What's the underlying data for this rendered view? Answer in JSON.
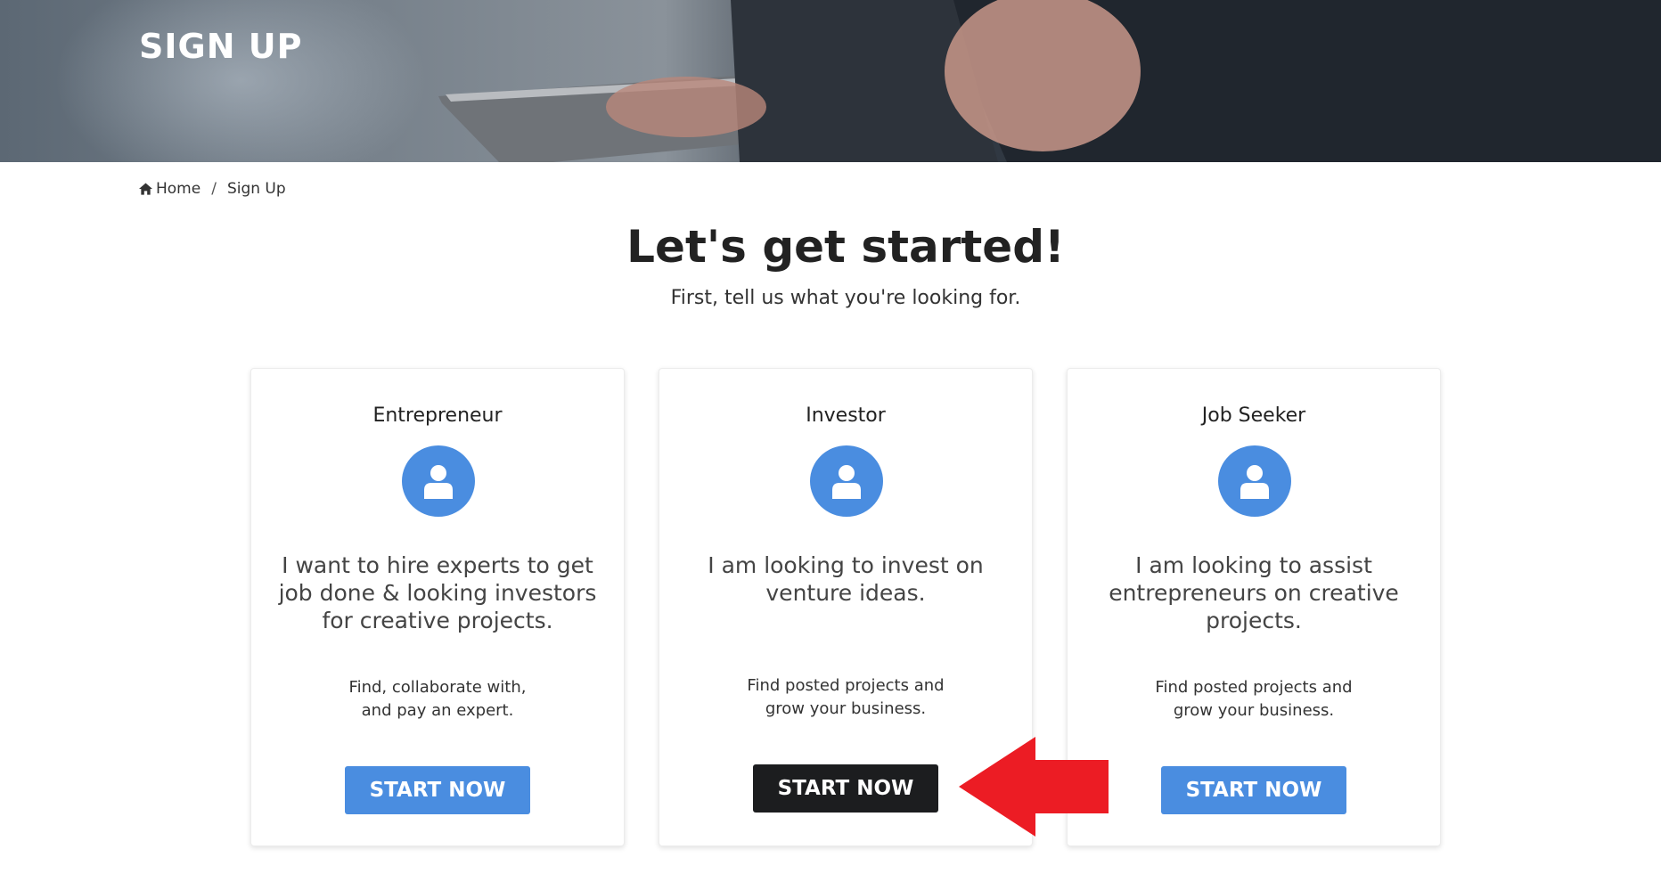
{
  "hero": {
    "title": "SIGN UP"
  },
  "breadcrumb": {
    "home": "Home",
    "separator": "/",
    "current": "Sign Up",
    "icon": "home-icon"
  },
  "intro": {
    "heading": "Let's get started!",
    "subheading": "First, tell us what you're looking for."
  },
  "cards": [
    {
      "role": "Entrepreneur",
      "icon": "user-icon",
      "description": [
        "I want to hire experts to get",
        "job done & looking investors",
        "for creative projects."
      ],
      "subtext": [
        "Find, collaborate with,",
        "and pay an expert."
      ],
      "button": "START NOW"
    },
    {
      "role": "Investor",
      "icon": "user-icon",
      "description": [
        "I am looking to invest on",
        "venture ideas."
      ],
      "subtext": [
        "Find posted projects and",
        "grow your business."
      ],
      "button": "START NOW"
    },
    {
      "role": "Job Seeker",
      "icon": "user-icon",
      "description": [
        "I am looking to assist",
        "entrepreneurs on creative",
        "projects."
      ],
      "subtext": [
        "Find posted projects and",
        "grow your business."
      ],
      "button": "START NOW"
    }
  ],
  "colors": {
    "accent": "#4a8de0",
    "highlight_button": "#1c1d1f",
    "annotation_arrow": "#ec1c24"
  }
}
